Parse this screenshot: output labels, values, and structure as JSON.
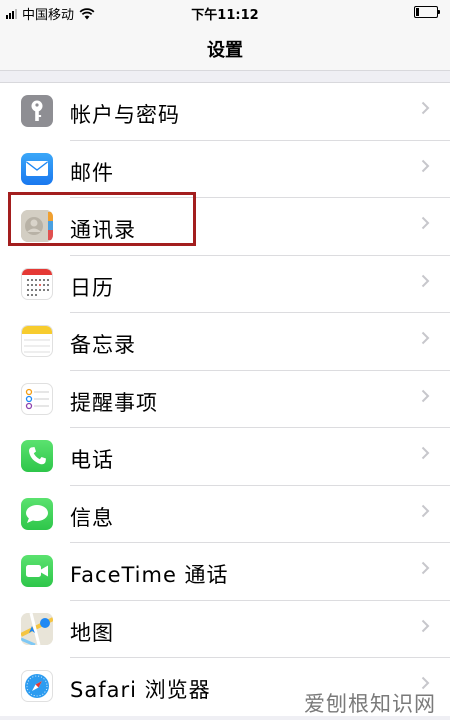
{
  "status_bar": {
    "carrier": "中国移动",
    "time": "下午11:12"
  },
  "nav": {
    "title": "设置"
  },
  "rows": [
    {
      "label": "帐户与密码",
      "icon": "key-icon",
      "color": "#8e8e93"
    },
    {
      "label": "邮件",
      "icon": "mail-icon",
      "color": "#1e88f4"
    },
    {
      "label": "通讯录",
      "icon": "contacts-icon",
      "color": "#c9c4b8"
    },
    {
      "label": "日历",
      "icon": "calendar-icon",
      "color": "#ffffff"
    },
    {
      "label": "备忘录",
      "icon": "notes-icon",
      "color": "#ffffff"
    },
    {
      "label": "提醒事项",
      "icon": "reminders-icon",
      "color": "#ffffff"
    },
    {
      "label": "电话",
      "icon": "phone-icon",
      "color": "#34c759"
    },
    {
      "label": "信息",
      "icon": "messages-icon",
      "color": "#34c759"
    },
    {
      "label": "FaceTime 通话",
      "icon": "facetime-icon",
      "color": "#34c759"
    },
    {
      "label": "地图",
      "icon": "maps-icon",
      "color": "#e8e4d8"
    },
    {
      "label": "Safari 浏览器",
      "icon": "safari-icon",
      "color": "#ffffff"
    }
  ],
  "highlight_color": "#a31e1e",
  "watermark": "爱刨根知识网"
}
